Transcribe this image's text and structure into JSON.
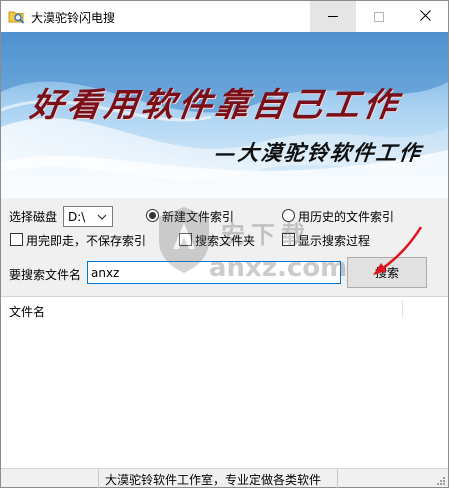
{
  "window": {
    "title": "大漠驼铃闪电搜",
    "app_icon": "folder-search-icon",
    "controls": [
      "minimize-icon",
      "maximize-icon",
      "close-icon"
    ]
  },
  "banner": {
    "slogan": "好看用软件靠自己工作",
    "signature": "—大漠驼铃软件工作"
  },
  "form": {
    "drive_label": "选择磁盘",
    "drive_value": "D:\\",
    "radio_new_index": "新建文件索引",
    "radio_history_index": "用历史的文件索引",
    "radio_selected": "new",
    "check_no_save": "用完即走，不保存索引",
    "check_search_folder": "搜索文件夹",
    "check_show_process": "显示搜索过程",
    "search_label": "要搜索文件名",
    "search_value": "anxz",
    "search_button": "搜索"
  },
  "results": {
    "columns": [
      "文件名"
    ]
  },
  "status": {
    "text": "大漠驼铃软件工作室，专业定做各类软件"
  },
  "watermark": {
    "text": "安下载",
    "url": "anxz.com"
  },
  "colors": {
    "accent_border": "#0078d7",
    "banner_title": "#7a0f1a",
    "arrow": "#e0141e"
  }
}
